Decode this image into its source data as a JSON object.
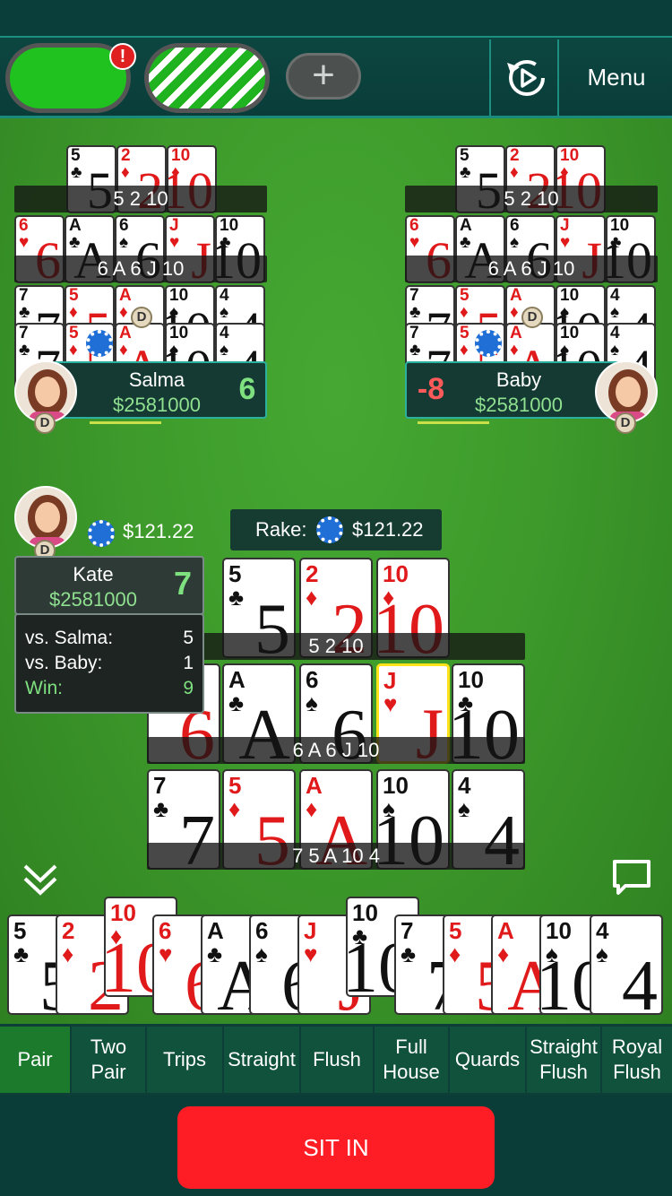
{
  "topbar": {
    "badge": "!",
    "add_label": "+",
    "menu_label": "Menu"
  },
  "opponents": {
    "salma": {
      "name": "Salma",
      "stack": "$2581000",
      "score": "6",
      "rows": {
        "top": {
          "label": "5 2 10",
          "cards": [
            {
              "rank": "5",
              "suit": "♣",
              "color": "black"
            },
            {
              "rank": "2",
              "suit": "♦",
              "color": "red"
            },
            {
              "rank": "10",
              "suit": "♦",
              "color": "red"
            }
          ]
        },
        "middle": {
          "label": "6 A 6 J 10",
          "cards": [
            {
              "rank": "6",
              "suit": "♥",
              "color": "red"
            },
            {
              "rank": "A",
              "suit": "♣",
              "color": "black"
            },
            {
              "rank": "6",
              "suit": "♠",
              "color": "black"
            },
            {
              "rank": "J",
              "suit": "♥",
              "color": "red"
            },
            {
              "rank": "10",
              "suit": "♣",
              "color": "black"
            }
          ]
        },
        "bottom": {
          "cards": [
            {
              "rank": "7",
              "suit": "♣",
              "color": "black"
            },
            {
              "rank": "5",
              "suit": "♦",
              "color": "red"
            },
            {
              "rank": "A",
              "suit": "♦",
              "color": "red"
            },
            {
              "rank": "10",
              "suit": "♠",
              "color": "black"
            },
            {
              "rank": "4",
              "suit": "♠",
              "color": "black"
            }
          ]
        }
      }
    },
    "baby": {
      "name": "Baby",
      "stack": "$2581000",
      "score": "-8",
      "rows": {
        "top": {
          "label": "5 2 10"
        },
        "middle": {
          "label": "6 A 6 J 10"
        }
      }
    }
  },
  "hero": {
    "name": "Kate",
    "stack": "$2581000",
    "score": "7",
    "bet": "$121.22",
    "results": [
      {
        "label": "vs. Salma:",
        "value": "5"
      },
      {
        "label": "vs. Baby:",
        "value": "1"
      },
      {
        "label": "Win:",
        "value": "9"
      }
    ],
    "rows": {
      "top": {
        "label": "5 2 10",
        "cards": [
          {
            "rank": "5",
            "suit": "♣",
            "color": "black"
          },
          {
            "rank": "2",
            "suit": "♦",
            "color": "red"
          },
          {
            "rank": "10",
            "suit": "♦",
            "color": "red"
          }
        ]
      },
      "middle": {
        "label": "6 A 6 J 10",
        "cards": [
          {
            "rank": "6",
            "suit": "♥",
            "color": "red"
          },
          {
            "rank": "A",
            "suit": "♣",
            "color": "black"
          },
          {
            "rank": "6",
            "suit": "♠",
            "color": "black"
          },
          {
            "rank": "J",
            "suit": "♥",
            "color": "red",
            "highlight": true
          },
          {
            "rank": "10",
            "suit": "♣",
            "color": "black"
          }
        ]
      },
      "bottom": {
        "label": "7 5 A 10 4",
        "cards": [
          {
            "rank": "7",
            "suit": "♣",
            "color": "black"
          },
          {
            "rank": "5",
            "suit": "♦",
            "color": "red"
          },
          {
            "rank": "A",
            "suit": "♦",
            "color": "red"
          },
          {
            "rank": "10",
            "suit": "♠",
            "color": "black"
          },
          {
            "rank": "4",
            "suit": "♠",
            "color": "black"
          }
        ]
      }
    }
  },
  "rake": {
    "label": "Rake:",
    "amount": "$121.22"
  },
  "dealer_label": "D",
  "hand_cards": [
    {
      "rank": "5",
      "suit": "♣",
      "color": "black"
    },
    {
      "rank": "2",
      "suit": "♦",
      "color": "red"
    },
    {
      "rank": "10",
      "suit": "♦",
      "color": "red",
      "raised": true
    },
    {
      "rank": "6",
      "suit": "♥",
      "color": "red"
    },
    {
      "rank": "A",
      "suit": "♣",
      "color": "black"
    },
    {
      "rank": "6",
      "suit": "♠",
      "color": "black"
    },
    {
      "rank": "J",
      "suit": "♥",
      "color": "red"
    },
    {
      "rank": "10",
      "suit": "♣",
      "color": "black",
      "raised": true
    },
    {
      "rank": "7",
      "suit": "♣",
      "color": "black"
    },
    {
      "rank": "5",
      "suit": "♦",
      "color": "red"
    },
    {
      "rank": "A",
      "suit": "♦",
      "color": "red"
    },
    {
      "rank": "10",
      "suit": "♠",
      "color": "black"
    },
    {
      "rank": "4",
      "suit": "♠",
      "color": "black"
    }
  ],
  "hints": [
    "Pair",
    "Two Pair",
    "Trips",
    "Straight",
    "Flush",
    "Full House",
    "Quards",
    "Straight Flush",
    "Royal Flush"
  ],
  "active_hint": "Pair",
  "sit_in_label": "SIT IN",
  "colors": {
    "felt": "#3d9a2b",
    "accent": "#2bb0a0",
    "sit_in": "#ff1d25",
    "score": "#7ee07e",
    "loss": "#ff5a5a",
    "money": "#8fe08f"
  },
  "icons": {
    "replay": "replay-icon",
    "collapse": "chevrons-down-icon",
    "chat": "chat-icon",
    "avatar": "avatar-icon",
    "chip": "chip-icon"
  }
}
